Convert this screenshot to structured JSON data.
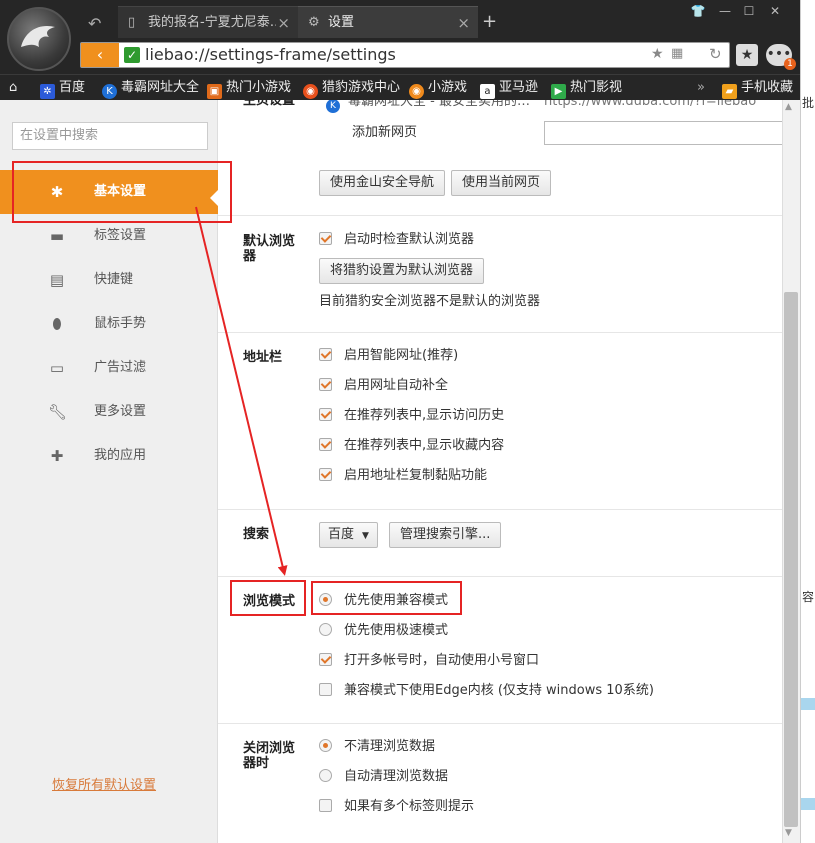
{
  "window": {
    "tabs": [
      {
        "label": "我的报名-宁夏尤尼泰…",
        "icon": "document-icon"
      },
      {
        "label": "设置",
        "icon": "gear-icon"
      }
    ],
    "new_tab": "+",
    "controls": [
      "shirt-icon",
      "minimize-icon",
      "maximize-icon",
      "close-icon"
    ]
  },
  "address_bar": {
    "url": "liebao://settings-frame/settings"
  },
  "bookmarks": [
    {
      "label": "百度",
      "color": "#2b5ad8",
      "icon": "paw-icon"
    },
    {
      "label": "毒霸网址大全",
      "color": "#1f6fd6",
      "icon": "k-logo-icon"
    },
    {
      "label": "热门小游戏",
      "color": "#e06a1a",
      "icon": "game-icon"
    },
    {
      "label": "猎豹游戏中心",
      "color": "#e8501c",
      "icon": "leopard-icon"
    },
    {
      "label": "小游戏",
      "color": "#f08a1c",
      "icon": "game-icon"
    },
    {
      "label": "亚马逊",
      "color": "#222222",
      "icon": "amazon-icon"
    },
    {
      "label": "热门影视",
      "color": "#2faa4a",
      "icon": "play-icon"
    },
    {
      "label": "手机收藏",
      "color": "#f0a01c",
      "icon": "folder-icon"
    }
  ],
  "bookmarks_more": "»",
  "menu_badge": "1",
  "sidebar": {
    "search_placeholder": "在设置中搜索",
    "items": [
      {
        "label": "基本设置",
        "icon": "gear-icon",
        "active": true
      },
      {
        "label": "标签设置",
        "icon": "tab-icon"
      },
      {
        "label": "快捷键",
        "icon": "keyboard-icon"
      },
      {
        "label": "鼠标手势",
        "icon": "mouse-icon"
      },
      {
        "label": "广告过滤",
        "icon": "window-icon"
      },
      {
        "label": "更多设置",
        "icon": "wrench-icon"
      },
      {
        "label": "我的应用",
        "icon": "puzzle-icon"
      }
    ],
    "restore_defaults": "恢复所有默认设置"
  },
  "content": {
    "homepage": {
      "title": "主页设置",
      "site_name": "毒霸网址大全 - 最安全实用的…",
      "site_url": "https://www.duba.com/?f=liebao",
      "add_label": "添加新网页",
      "add_value": "",
      "btn_safe_nav": "使用金山安全导航",
      "btn_current": "使用当前网页"
    },
    "default_browser": {
      "title": "默认浏览器",
      "check_on_start": "启动时检查默认浏览器",
      "btn_set_default": "将猎豹设置为默认浏览器",
      "status": "目前猎豹安全浏览器不是默认的浏览器"
    },
    "address": {
      "title": "地址栏",
      "items": [
        "启用智能网址(推荐)",
        "启用网址自动补全",
        "在推荐列表中,显示访问历史",
        "在推荐列表中,显示收藏内容",
        "启用地址栏复制黏贴功能"
      ]
    },
    "search": {
      "title": "搜索",
      "engine": "百度",
      "btn_manage": "管理搜索引擎..."
    },
    "browse_mode": {
      "title": "浏览模式",
      "opt_compat": "优先使用兼容模式",
      "opt_speed": "优先使用极速模式",
      "multi_account": "打开多帐号时，自动使用小号窗口",
      "edge_kernel": "兼容模式下使用Edge内核 (仅支持 windows 10系统)"
    },
    "close_browser": {
      "title": "关闭浏览器时",
      "opt_keep": "不清理浏览数据",
      "opt_clean": "自动清理浏览数据",
      "multi_tab_prompt": "如果有多个标签则提示"
    }
  },
  "right_strip_text": [
    "批",
    "容"
  ],
  "accent_color": "#f0901e",
  "annotation_color": "#e52424"
}
